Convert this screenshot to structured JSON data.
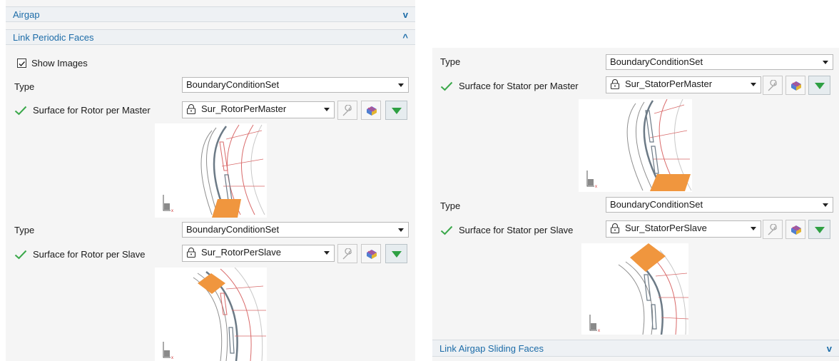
{
  "left": {
    "airgap_header": "Airgap",
    "link_header": "Link Periodic Faces",
    "show_images": "Show Images",
    "type_label": "Type",
    "type_value": "BoundaryConditionSet",
    "rotor_master_label": "Surface for Rotor per Master",
    "rotor_master_value": "Sur_RotorPerMaster",
    "type2_label": "Type",
    "type2_value": "BoundaryConditionSet",
    "rotor_slave_label": "Surface for Rotor per Slave",
    "rotor_slave_value": "Sur_RotorPerSlave"
  },
  "right": {
    "type_label": "Type",
    "type_value": "BoundaryConditionSet",
    "stator_master_label": "Surface for Stator per Master",
    "stator_master_value": "Sur_StatorPerMaster",
    "type2_label": "Type",
    "type2_value": "BoundaryConditionSet",
    "stator_slave_label": "Surface for Stator per Slave",
    "stator_slave_value": "Sur_StatorPerSlave",
    "airgap_sliding_header": "Link Airgap Sliding Faces"
  },
  "colors": {
    "accent": "#1c6ca8",
    "check": "#3aa84a",
    "face": "#f0963e"
  },
  "icons": [
    "chevron-down-icon",
    "chevron-up-icon",
    "checkmark-icon",
    "lock-icon",
    "wrench-icon",
    "mesh-icon",
    "triangle-down-icon"
  ]
}
